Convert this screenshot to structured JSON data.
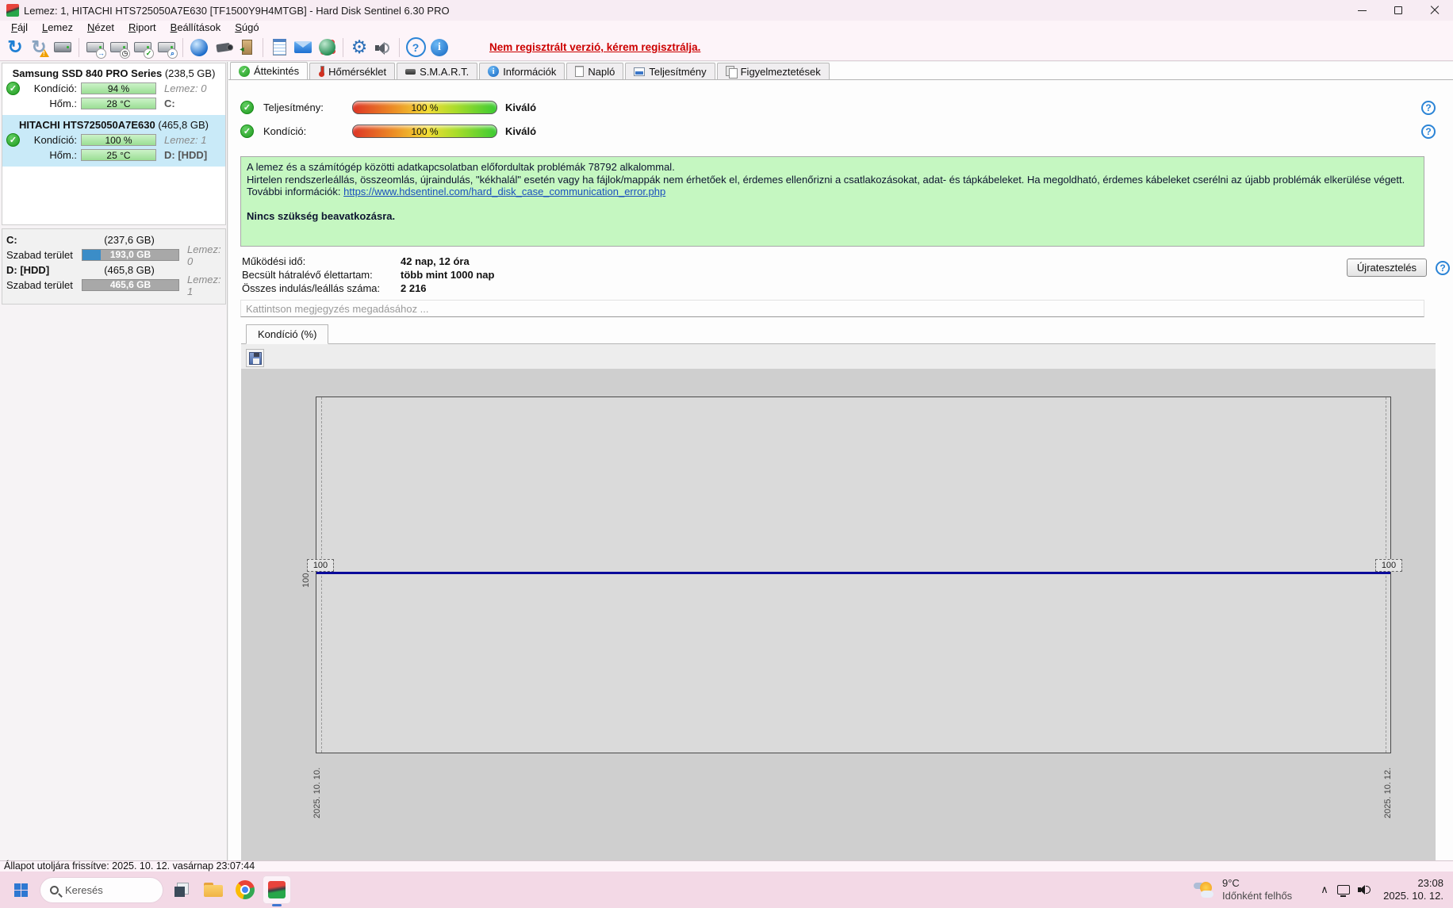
{
  "window": {
    "title": "Lemez: 1, HITACHI HTS725050A7E630 [TF1500Y9H4MTGB]  -  Hard Disk Sentinel 6.30 PRO"
  },
  "menu": {
    "items": [
      {
        "key": "F",
        "rest": "ájl"
      },
      {
        "key": "L",
        "rest": "emez"
      },
      {
        "key": "N",
        "rest": "ézet"
      },
      {
        "key": "R",
        "rest": "iport"
      },
      {
        "key": "B",
        "rest": "eállítások"
      },
      {
        "key": "S",
        "rest": "úgó"
      }
    ]
  },
  "toolbar": {
    "icons": [
      "refresh",
      "refresh-warning",
      "disk-properties",
      "disk-arrow",
      "disk-clock",
      "disk-ok",
      "disk-search",
      "web-disk",
      "camera",
      "door-exit",
      "notes",
      "email",
      "network-globe",
      "settings-gear",
      "sounds-speaker",
      "help",
      "information"
    ],
    "registration_notice": "Nem regisztrált verzió, kérem regisztrálja."
  },
  "sidebar": {
    "disks": [
      {
        "name": "Samsung SSD 840 PRO Series",
        "size": "(238,5 GB)",
        "condition_label": "Kondíció:",
        "condition_value": "94 %",
        "temp_label": "Hőm.:",
        "temp_value": "28 °C",
        "disk_label": "Lemez: 0",
        "drive": "C:"
      },
      {
        "name": "HITACHI HTS725050A7E630",
        "size": "(465,8 GB)",
        "condition_label": "Kondíció:",
        "condition_value": "100 %",
        "temp_label": "Hőm.:",
        "temp_value": "25 °C",
        "disk_label": "Lemez: 1",
        "drive": "D: [HDD]"
      }
    ],
    "partitions": [
      {
        "name": "C:",
        "size": "(237,6 GB)",
        "free_label": "Szabad terület",
        "free_value": "193,0 GB",
        "disk_label": "Lemez: 0"
      },
      {
        "name": "D: [HDD]",
        "size": "(465,8 GB)",
        "free_label": "Szabad terület",
        "free_value": "465,6 GB",
        "disk_label": "Lemez: 1"
      }
    ]
  },
  "tabs": {
    "items": [
      {
        "label": "Áttekintés"
      },
      {
        "label": "Hőmérséklet"
      },
      {
        "label": "S.M.A.R.T."
      },
      {
        "label": "Információk"
      },
      {
        "label": "Napló"
      },
      {
        "label": "Teljesítmény"
      },
      {
        "label": "Figyelmeztetések"
      }
    ]
  },
  "overview": {
    "performance_label": "Teljesítmény:",
    "performance_value": "100 %",
    "performance_rating": "Kiváló",
    "condition_label": "Kondíció:",
    "condition_value": "100 %",
    "condition_rating": "Kiváló",
    "message": {
      "line1": "A lemez és a számítógép közötti adatkapcsolatban előfordultak problémák 78792 alkalommal.",
      "line2": "Hirtelen rendszerleállás, összeomlás, újraindulás, \"kékhalál\" esetén vagy ha fájlok/mappák nem érhetőek el, érdemes ellenőrizni a csatlakozásokat, adat- és tápkábeleket. Ha megoldható, érdemes kábeleket cserélni az újabb problémák elkerülése végett.",
      "info_prefix": "További információk: ",
      "info_link": "https://www.hdsentinel.com/hard_disk_case_communication_error.php",
      "action": "Nincs szükség beavatkozásra."
    },
    "stats": [
      {
        "label": "Működési idő:",
        "value": "42 nap, 12 óra"
      },
      {
        "label": "Becsült hátralévő élettartam:",
        "value": "több mint 1000 nap"
      },
      {
        "label": "Összes indulás/leállás száma:",
        "value": "2 216"
      }
    ],
    "retest_button": "Újratesztelés",
    "comment_placeholder": "Kattintson megjegyzés megadásához ..."
  },
  "chart": {
    "tab_label": "Kondíció  (%)",
    "y_axis_tick": "100",
    "point_labels": {
      "left": "100",
      "right": "100"
    },
    "x_labels": [
      "2025. 10. 10.",
      "2025. 10. 12."
    ],
    "line_color": "#0a0a9a"
  },
  "chart_data": {
    "type": "line",
    "title": "Kondíció (%)",
    "x": [
      "2025. 10. 10.",
      "2025. 10. 12."
    ],
    "series": [
      {
        "name": "Kondíció %",
        "values": [
          100,
          100
        ]
      }
    ],
    "ylabel": "Kondíció (%)",
    "y_ticks": [
      100
    ],
    "grid": "dashed-vertical-at-ends",
    "legend_position": "none"
  },
  "status_bar": {
    "text": "Állapot utoljára frissítve: 2025. 10. 12. vasárnap 23:07:44"
  },
  "taskbar": {
    "search_placeholder": "Keresés",
    "weather": {
      "temp": "9°C",
      "condition": "Időnként felhős"
    },
    "tray_chevron": "∧",
    "clock": {
      "time": "23:08",
      "date": "2025. 10. 12."
    }
  }
}
